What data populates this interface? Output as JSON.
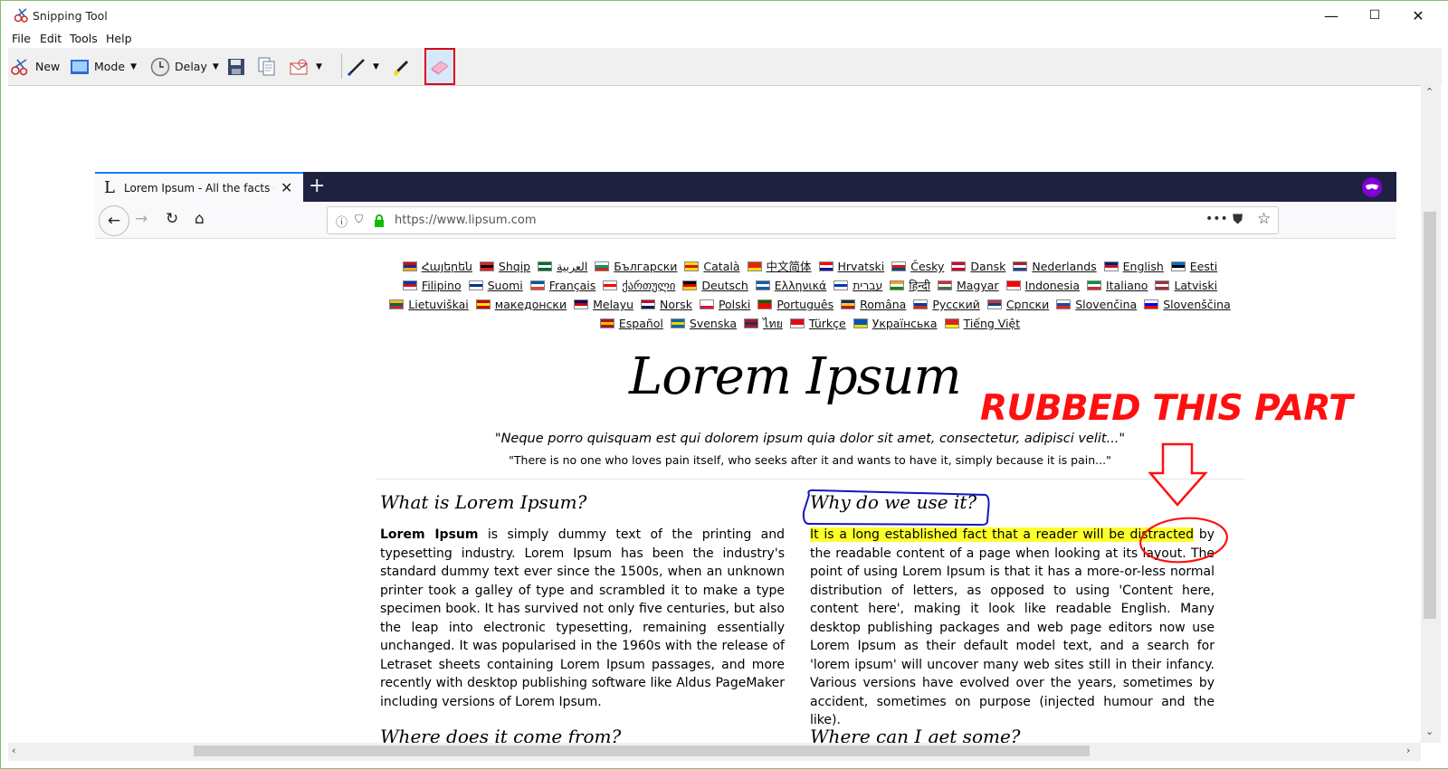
{
  "window": {
    "title": "Snipping Tool",
    "controls": {
      "minimize": "—",
      "maximize": "☐",
      "close": "✕"
    }
  },
  "menu": [
    "File",
    "Edit",
    "Tools",
    "Help"
  ],
  "toolbar": {
    "new_label": "New",
    "mode_label": "Mode",
    "delay_label": "Delay",
    "selected_tool": "eraser-icon",
    "accent": "#e2001a"
  },
  "browser": {
    "tab_title": "Lorem Ipsum - All the facts - Lip",
    "tab_favicon": "L",
    "url": "https://www.lipsum.com",
    "private_mask_color": "#8000d7"
  },
  "page": {
    "languages": [
      {
        "name": "Հայերեն",
        "colors": [
          "#d90012",
          "#0033a0",
          "#f2a800"
        ]
      },
      {
        "name": "Shqip",
        "colors": [
          "#e41e20",
          "#000",
          "#e41e20"
        ]
      },
      {
        "name": "العربية",
        "colors": [
          "#006c35",
          "#fff",
          "#006c35"
        ]
      },
      {
        "name": "Български",
        "colors": [
          "#fff",
          "#00966e",
          "#d62612"
        ]
      },
      {
        "name": "Català",
        "colors": [
          "#fcdd09",
          "#da121a",
          "#fcdd09"
        ]
      },
      {
        "name": "中文简体",
        "colors": [
          "#de2910",
          "#de2910",
          "#ffde00"
        ]
      },
      {
        "name": "Hrvatski",
        "colors": [
          "#ff0000",
          "#fff",
          "#171796"
        ]
      },
      {
        "name": "Česky",
        "colors": [
          "#fff",
          "#d7141a",
          "#11457e"
        ]
      },
      {
        "name": "Dansk",
        "colors": [
          "#c60c30",
          "#fff",
          "#c60c30"
        ]
      },
      {
        "name": "Nederlands",
        "colors": [
          "#ae1c28",
          "#fff",
          "#21468b"
        ]
      },
      {
        "name": "English",
        "colors": [
          "#012169",
          "#c8102e",
          "#fff"
        ]
      },
      {
        "name": "Eesti",
        "colors": [
          "#0072ce",
          "#000",
          "#fff"
        ]
      },
      {
        "name": "Filipino",
        "colors": [
          "#0038a8",
          "#ce1126",
          "#fff"
        ]
      },
      {
        "name": "Suomi",
        "colors": [
          "#fff",
          "#003580",
          "#fff"
        ]
      },
      {
        "name": "Français",
        "colors": [
          "#0055a4",
          "#fff",
          "#ef4135"
        ]
      },
      {
        "name": "ქართული",
        "colors": [
          "#fff",
          "#ff0000",
          "#fff"
        ]
      },
      {
        "name": "Deutsch",
        "colors": [
          "#000",
          "#dd0000",
          "#ffce00"
        ]
      },
      {
        "name": "Ελληνικά",
        "colors": [
          "#0d5eaf",
          "#fff",
          "#0d5eaf"
        ]
      },
      {
        "name": "עברית",
        "colors": [
          "#fff",
          "#0038b8",
          "#fff"
        ]
      },
      {
        "name": "हिन्दी",
        "colors": [
          "#ff9933",
          "#fff",
          "#138808"
        ]
      },
      {
        "name": "Magyar",
        "colors": [
          "#cd2a3e",
          "#fff",
          "#436f4d"
        ]
      },
      {
        "name": "Indonesia",
        "colors": [
          "#ff0000",
          "#ff0000",
          "#fff"
        ]
      },
      {
        "name": "Italiano",
        "colors": [
          "#009246",
          "#fff",
          "#ce2b37"
        ]
      },
      {
        "name": "Latviski",
        "colors": [
          "#9e3039",
          "#fff",
          "#9e3039"
        ]
      },
      {
        "name": "Lietuviškai",
        "colors": [
          "#fdb913",
          "#006a44",
          "#c1272d"
        ]
      },
      {
        "name": "македонски",
        "colors": [
          "#d20000",
          "#ffe600",
          "#d20000"
        ]
      },
      {
        "name": "Melayu",
        "colors": [
          "#010066",
          "#cc0001",
          "#fff"
        ]
      },
      {
        "name": "Norsk",
        "colors": [
          "#ba0c2f",
          "#fff",
          "#00205b"
        ]
      },
      {
        "name": "Polski",
        "colors": [
          "#fff",
          "#fff",
          "#dc143c"
        ]
      },
      {
        "name": "Português",
        "colors": [
          "#006600",
          "#ff0000",
          "#ff0000"
        ]
      },
      {
        "name": "Româna",
        "colors": [
          "#002b7f",
          "#fcd116",
          "#ce1126"
        ]
      },
      {
        "name": "Pусский",
        "colors": [
          "#fff",
          "#0039a6",
          "#d52b1e"
        ]
      },
      {
        "name": "Српски",
        "colors": [
          "#c6363c",
          "#0c4076",
          "#fff"
        ]
      },
      {
        "name": "Slovenčina",
        "colors": [
          "#fff",
          "#0b4ea2",
          "#ee1c25"
        ]
      },
      {
        "name": "Slovenščina",
        "colors": [
          "#fff",
          "#0000ff",
          "#ff0000"
        ]
      },
      {
        "name": "Español",
        "colors": [
          "#aa151b",
          "#f1bf00",
          "#aa151b"
        ]
      },
      {
        "name": "Svenska",
        "colors": [
          "#006aa7",
          "#fecc00",
          "#006aa7"
        ]
      },
      {
        "name": "ไทย",
        "colors": [
          "#a51931",
          "#2d2a4a",
          "#a51931"
        ]
      },
      {
        "name": "Türkçe",
        "colors": [
          "#e30a17",
          "#e30a17",
          "#fff"
        ]
      },
      {
        "name": "Українська",
        "colors": [
          "#0057b7",
          "#0057b7",
          "#ffd700"
        ]
      },
      {
        "name": "Tiếng Việt",
        "colors": [
          "#da251d",
          "#da251d",
          "#ffff00"
        ]
      }
    ],
    "title": "Lorem Ipsum",
    "quote_latin": "\"Neque porro quisquam est qui dolorem ipsum quia dolor sit amet, consectetur, adipisci velit...\"",
    "quote_english": "\"There is no one who loves pain itself, who seeks after it and wants to have it, simply because it is pain...\"",
    "left": {
      "heading": "What is Lorem Ipsum?",
      "bold_lead": "Lorem Ipsum",
      "text": " is simply dummy text of the printing and typesetting industry. Lorem Ipsum has been the industry's standard dummy text ever since the 1500s, when an unknown printer took a galley of type and scrambled it to make a type specimen book. It has survived not only five centuries, but also the leap into electronic typesetting, remaining essentially unchanged. It was popularised in the 1960s with the release of Letraset sheets containing Lorem Ipsum passages, and more recently with desktop publishing software like Aldus PageMaker including versions of Lorem Ipsum.",
      "next_heading": "Where does it come from?"
    },
    "right": {
      "heading": "Why do we use it?",
      "highlighted": "It is a long established fact that a reader will be distracted",
      "text": " by the readable content of a page when looking at its layout. The point of using Lorem Ipsum is that it has a more-or-less normal distribution of letters, as opposed to using 'Content here, content here', making it look like readable English. Many desktop publishing packages and web page editors now use Lorem Ipsum as their default model text, and a search for 'lorem ipsum' will uncover many web sites still in their infancy. Various versions have evolved over the years, sometimes by accident, sometimes on purpose (injected humour and the like).",
      "next_heading": "Where can I get some?"
    }
  },
  "annotation": {
    "callout": "RUBBED THIS PART",
    "callout_color": "#ff1010",
    "pen_color": "#1010d0",
    "highlighter_color": "#ffff2a"
  }
}
